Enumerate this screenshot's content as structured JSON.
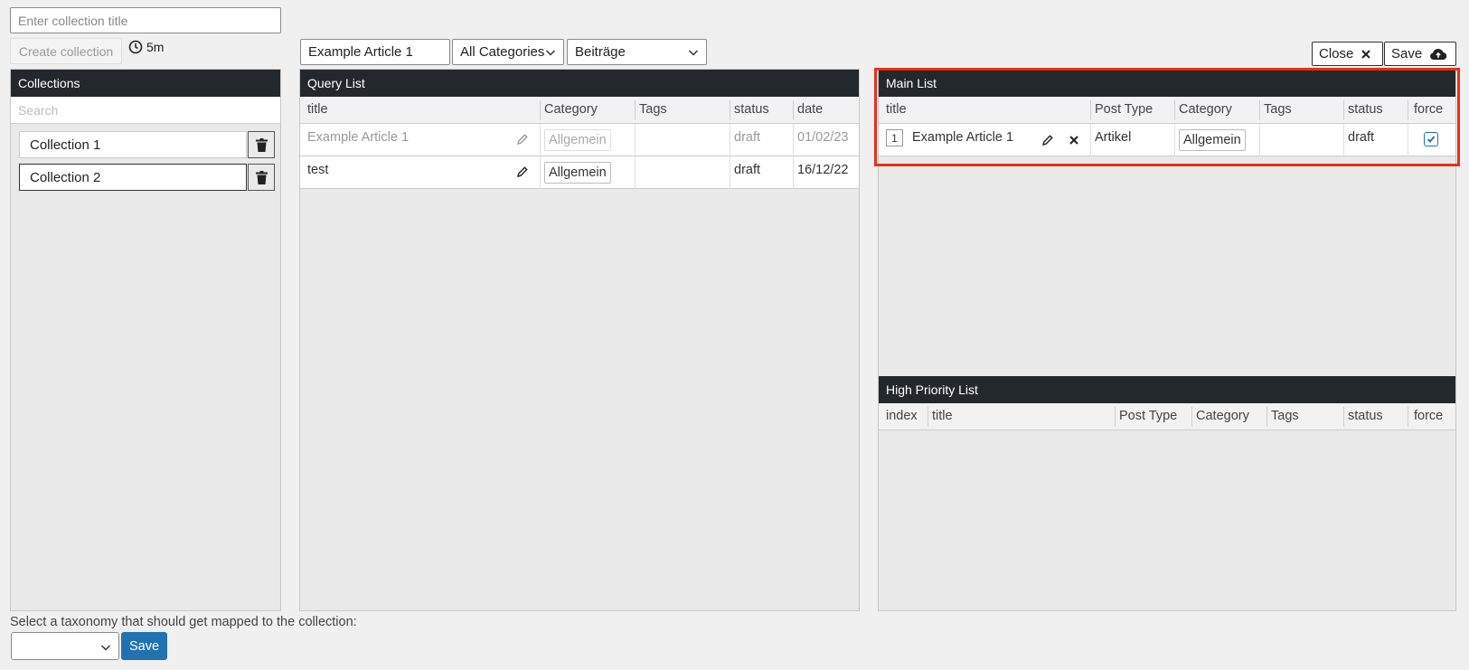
{
  "collection_form": {
    "title_placeholder": "Enter collection title",
    "create_button": "Create collection",
    "timer_label": "5m"
  },
  "collections": {
    "header": "Collections",
    "search_placeholder": "Search",
    "items": [
      {
        "label": "Collection 1",
        "active": false
      },
      {
        "label": "Collection 2",
        "active": true
      }
    ]
  },
  "filters": {
    "search_value": "Example Article 1",
    "category_select": "All Categories",
    "post_type_select": "Beiträge"
  },
  "query_list": {
    "header": "Query List",
    "columns": [
      "title",
      "Category",
      "Tags",
      "status",
      "date"
    ],
    "rows": [
      {
        "title": "Example Article 1",
        "category": "Allgemein",
        "tags": "",
        "status": "draft",
        "date": "01/02/23",
        "faded": true
      },
      {
        "title": "test",
        "category": "Allgemein",
        "tags": "",
        "status": "draft",
        "date": "16/12/22",
        "faded": false
      }
    ]
  },
  "toolbar": {
    "close_label": "Close",
    "save_label": "Save"
  },
  "main_list": {
    "header": "Main List",
    "columns": [
      "title",
      "Post Type",
      "Category",
      "Tags",
      "status",
      "force"
    ],
    "rows": [
      {
        "index": "1",
        "title": "Example Article 1",
        "post_type": "Artikel",
        "category": "Allgemein",
        "tags": "",
        "status": "draft",
        "force": true
      }
    ]
  },
  "high_priority_list": {
    "header": "High Priority List",
    "columns": [
      "index",
      "title",
      "Post Type",
      "Category",
      "Tags",
      "status",
      "force"
    ]
  },
  "taxonomy": {
    "label": "Select a taxonomy that should get mapped to the collection:",
    "selected": "",
    "save_label": "Save"
  },
  "colors": {
    "panel_header_bg": "#23282d",
    "highlight_border": "#e53019",
    "primary_button": "#2271b1"
  }
}
